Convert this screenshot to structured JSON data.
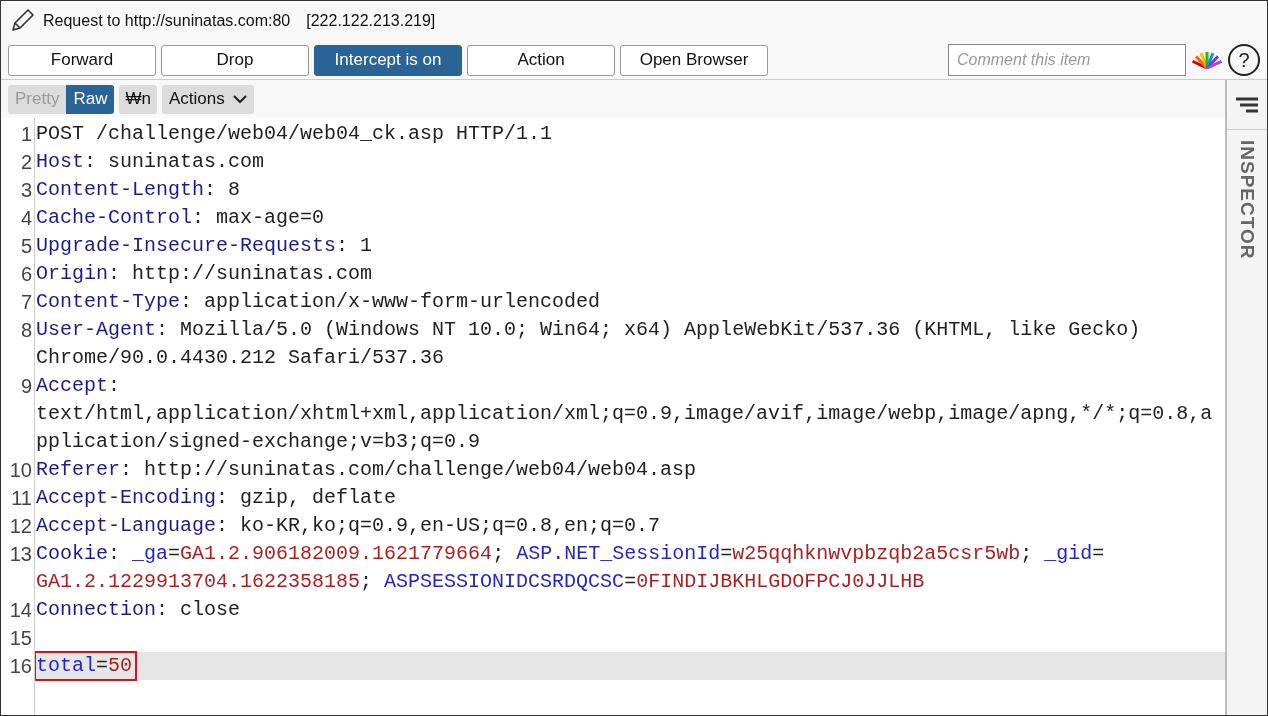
{
  "window": {
    "title": "Request to http://suninatas.com:80",
    "address": "[222.122.213.219]"
  },
  "buttons": [
    {
      "label": "Forward",
      "selected": false
    },
    {
      "label": "Drop",
      "selected": false
    },
    {
      "label": "Intercept is on",
      "selected": true
    },
    {
      "label": "Action",
      "selected": false
    },
    {
      "label": "Open Browser",
      "selected": false
    }
  ],
  "comment": {
    "placeholder": "Comment this item"
  },
  "help": {
    "label": "?"
  },
  "view_tabs": [
    {
      "label": "Pretty",
      "selected": false
    },
    {
      "label": "Raw",
      "selected": true
    }
  ],
  "newline_toggle": {
    "label": "₩n",
    "on": false
  },
  "actions_menu": {
    "label": "Actions"
  },
  "inspector": {
    "label": "INSPECTOR"
  },
  "lines": [
    {
      "number": "1",
      "current": false,
      "boxed": false,
      "segments": [
        {
          "kind": "text",
          "text": "POST /challenge/web04/web04_ck.asp HTTP/1.1"
        }
      ]
    },
    {
      "number": "2",
      "current": false,
      "boxed": false,
      "segments": [
        {
          "kind": "header",
          "text": "Host"
        },
        {
          "kind": "text",
          "text": ": suninatas.com"
        }
      ]
    },
    {
      "number": "3",
      "current": false,
      "boxed": false,
      "segments": [
        {
          "kind": "header",
          "text": "Content-Length"
        },
        {
          "kind": "text",
          "text": ": 8"
        }
      ]
    },
    {
      "number": "4",
      "current": false,
      "boxed": false,
      "segments": [
        {
          "kind": "header",
          "text": "Cache-Control"
        },
        {
          "kind": "text",
          "text": ": max-age=0"
        }
      ]
    },
    {
      "number": "5",
      "current": false,
      "boxed": false,
      "segments": [
        {
          "kind": "header",
          "text": "Upgrade-Insecure-Requests"
        },
        {
          "kind": "text",
          "text": ": 1"
        }
      ]
    },
    {
      "number": "6",
      "current": false,
      "boxed": false,
      "segments": [
        {
          "kind": "header",
          "text": "Origin"
        },
        {
          "kind": "text",
          "text": ": http://suninatas.com"
        }
      ]
    },
    {
      "number": "7",
      "current": false,
      "boxed": false,
      "segments": [
        {
          "kind": "header",
          "text": "Content-Type"
        },
        {
          "kind": "text",
          "text": ": application/x-www-form-urlencoded"
        }
      ]
    },
    {
      "number": "8",
      "current": false,
      "boxed": false,
      "segments": [
        {
          "kind": "header",
          "text": "User-Agent"
        },
        {
          "kind": "text",
          "text": ": Mozilla/5.0 (Windows NT 10.0; Win64; x64) AppleWebKit/537.36 (KHTML, like Gecko)"
        },
        {
          "kind": "break"
        },
        {
          "kind": "text",
          "text": "Chrome/90.0.4430.212 Safari/537.36"
        }
      ]
    },
    {
      "number": "9",
      "current": false,
      "boxed": false,
      "segments": [
        {
          "kind": "header",
          "text": "Accept"
        },
        {
          "kind": "text",
          "text": ":"
        },
        {
          "kind": "break"
        },
        {
          "kind": "text",
          "text": "text/html,application/xhtml+xml,application/xml;q=0.9,image/avif,image/webp,image/apng,*/*;q=0.8,a"
        },
        {
          "kind": "break"
        },
        {
          "kind": "text",
          "text": "pplication/signed-exchange;v=b3;q=0.9"
        }
      ]
    },
    {
      "number": "10",
      "current": false,
      "boxed": false,
      "segments": [
        {
          "kind": "header",
          "text": "Referer"
        },
        {
          "kind": "text",
          "text": ": http://suninatas.com/challenge/web04/web04.asp"
        }
      ]
    },
    {
      "number": "11",
      "current": false,
      "boxed": false,
      "segments": [
        {
          "kind": "header",
          "text": "Accept-Encoding"
        },
        {
          "kind": "text",
          "text": ": gzip, deflate"
        }
      ]
    },
    {
      "number": "12",
      "current": false,
      "boxed": false,
      "segments": [
        {
          "kind": "header",
          "text": "Accept-Language"
        },
        {
          "kind": "text",
          "text": ": ko-KR,ko;q=0.9,en-US;q=0.8,en;q=0.7"
        }
      ]
    },
    {
      "number": "13",
      "current": false,
      "boxed": false,
      "segments": [
        {
          "kind": "header",
          "text": "Cookie"
        },
        {
          "kind": "text",
          "text": ": "
        },
        {
          "kind": "name",
          "text": "_ga"
        },
        {
          "kind": "text",
          "text": "="
        },
        {
          "kind": "value",
          "text": "GA1.2.906182009.1621779664"
        },
        {
          "kind": "text",
          "text": "; "
        },
        {
          "kind": "name",
          "text": "ASP.NET_SessionId"
        },
        {
          "kind": "text",
          "text": "="
        },
        {
          "kind": "value",
          "text": "w25qqhknwvpbzqb2a5csr5wb"
        },
        {
          "kind": "text",
          "text": "; "
        },
        {
          "kind": "name",
          "text": "_gid"
        },
        {
          "kind": "text",
          "text": "="
        },
        {
          "kind": "break"
        },
        {
          "kind": "value",
          "text": "GA1.2.1229913704.1622358185"
        },
        {
          "kind": "text",
          "text": "; "
        },
        {
          "kind": "name",
          "text": "ASPSESSIONIDCSRDQCSC"
        },
        {
          "kind": "text",
          "text": "="
        },
        {
          "kind": "value",
          "text": "0FINDIJBKHLGDOFPCJ0JJLHB"
        }
      ]
    },
    {
      "number": "14",
      "current": false,
      "boxed": false,
      "segments": [
        {
          "kind": "header",
          "text": "Connection"
        },
        {
          "kind": "text",
          "text": ": close"
        }
      ]
    },
    {
      "number": "15",
      "current": false,
      "boxed": false
    },
    {
      "number": "16",
      "current": true,
      "boxed": true,
      "segments": [
        {
          "kind": "name",
          "text": "total"
        },
        {
          "kind": "text",
          "text": "="
        },
        {
          "kind": "value",
          "text": "50"
        }
      ]
    }
  ]
}
